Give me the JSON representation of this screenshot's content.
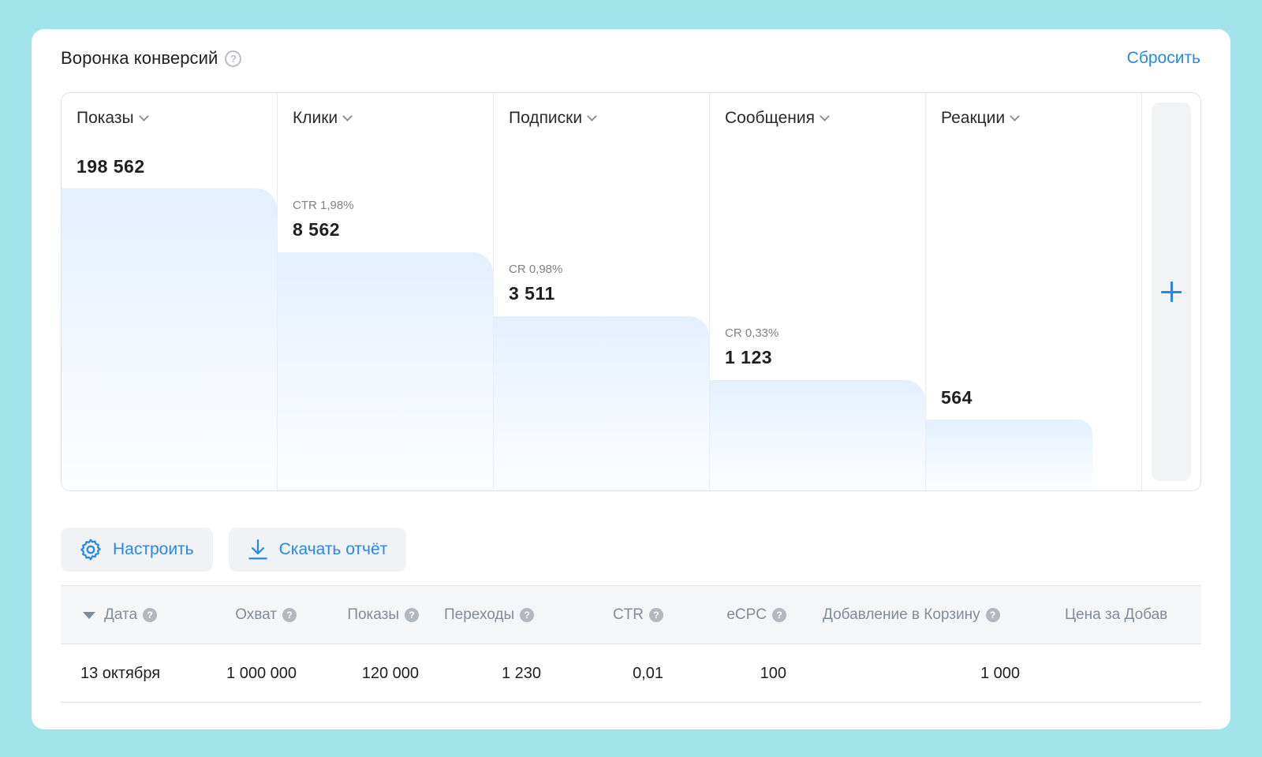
{
  "header": {
    "title": "Воронка конверсий",
    "help": "?",
    "reset_label": "Сбросить"
  },
  "funnel": {
    "stages": [
      {
        "label": "Показы",
        "metric": "",
        "value": "198 562",
        "count": 198562
      },
      {
        "label": "Клики",
        "metric": "CTR 1,98%",
        "value": "8 562",
        "count": 8562
      },
      {
        "label": "Подписки",
        "metric": "CR 0,98%",
        "value": "3 511",
        "count": 3511
      },
      {
        "label": "Сообщения",
        "metric": "CR 0,33%",
        "value": "1 123",
        "count": 1123
      },
      {
        "label": "Реакции",
        "metric": "",
        "value": "564",
        "count": 564
      }
    ],
    "add_icon": "plus-icon"
  },
  "actions": {
    "configure_label": "Настроить",
    "download_label": "Скачать отчёт"
  },
  "table": {
    "help": "?",
    "columns": [
      "Дата",
      "Охват",
      "Показы",
      "Переходы",
      "CTR",
      "eCPC",
      "Добавление в Корзину",
      "Цена за Добав"
    ],
    "rows": [
      [
        "13 октября",
        "1 000 000",
        "120 000",
        "1 230",
        "0,01",
        "100",
        "1 000",
        ""
      ]
    ]
  },
  "colors": {
    "accent": "#2688eb",
    "background": "#a3e4ea",
    "bar": "#e4effd"
  }
}
